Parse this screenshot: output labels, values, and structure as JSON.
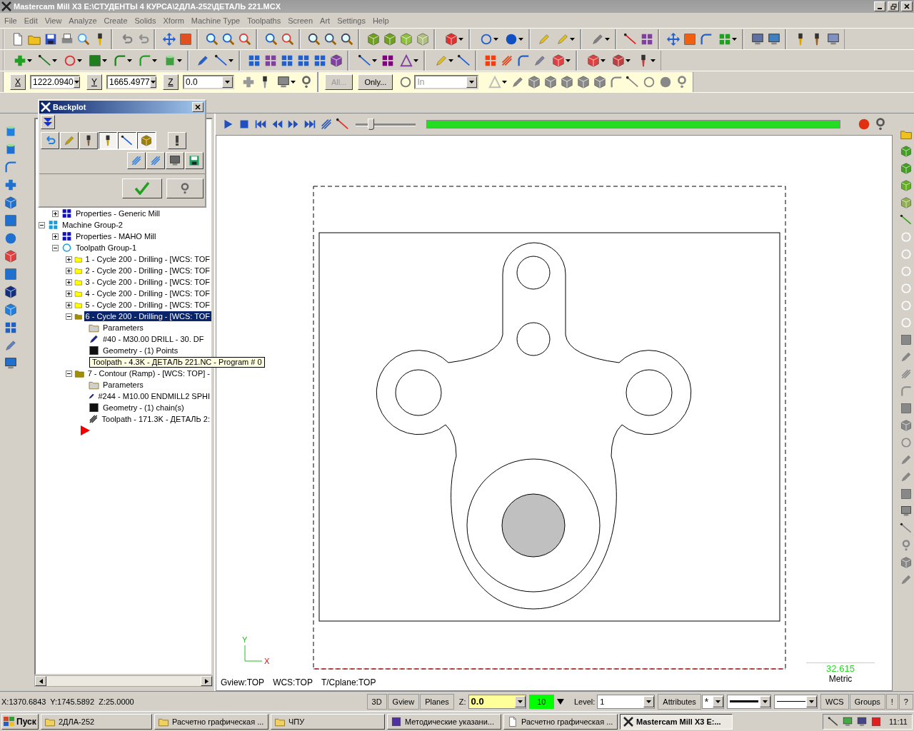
{
  "window": {
    "title": "Mastercam Mill X3  E:\\СТУДЕНТЫ 4 КУРСА\\2ДЛА-252\\ДЕТАЛЬ 221.MCX"
  },
  "menu": [
    "File",
    "Edit",
    "View",
    "Analyze",
    "Create",
    "Solids",
    "Xform",
    "Machine Type",
    "Toolpaths",
    "Screen",
    "Art",
    "Settings",
    "Help"
  ],
  "coordinate_bar": {
    "x_label": "X",
    "x_value": "1222.0940",
    "y_label": "Y",
    "y_value": "1665.4977",
    "z_label": "Z",
    "z_value": "0.0",
    "all_button": "All...",
    "only_button": "Only...",
    "units": "In"
  },
  "backplot": {
    "title": "Backplot",
    "display_options": [
      {
        "pressed": false
      },
      {
        "pressed": false
      },
      {
        "pressed": false
      },
      {
        "pressed": true
      },
      {
        "pressed": true
      },
      {
        "pressed": true
      }
    ]
  },
  "operations_tree": {
    "items": [
      {
        "children": [
          {
            "label": "Properties - Generic Mill",
            "kind": "properties",
            "expanded": false
          }
        ]
      },
      {
        "label": "Machine Group-2",
        "kind": "machine-group",
        "expanded": true,
        "selected": false,
        "children": [
          {
            "label": "Properties - MAHO Mill",
            "kind": "properties",
            "expanded": false,
            "selected": false
          },
          {
            "label": "Toolpath Group-1",
            "kind": "toolpath-group",
            "expanded": true,
            "selected": false,
            "children": [
              {
                "label": "1 - Cycle 200 - Drilling - [WCS: TOF",
                "kind": "folder",
                "expanded": false,
                "selected": false
              },
              {
                "label": "2 - Cycle 200 - Drilling - [WCS: TOF",
                "kind": "folder",
                "expanded": false,
                "selected": false
              },
              {
                "label": "3 - Cycle 200 - Drilling - [WCS: TOF",
                "kind": "folder",
                "expanded": false,
                "selected": false
              },
              {
                "label": "4 - Cycle 200 - Drilling - [WCS: TOF",
                "kind": "folder",
                "expanded": false,
                "selected": false
              },
              {
                "label": "5 - Cycle 200 - Drilling - [WCS: TOF",
                "kind": "folder",
                "expanded": false,
                "selected": false
              },
              {
                "label": "6 - Cycle 200 - Drilling - [WCS: TOF",
                "kind": "open-folder",
                "expanded": true,
                "selected": true,
                "children": [
                  {
                    "label": "Parameters",
                    "kind": "parameters",
                    "selected": false
                  },
                  {
                    "label": "#40 - M30.00 DRILL -    30. DF",
                    "kind": "tool",
                    "selected": false
                  },
                  {
                    "label": "Geometry - (1) Points",
                    "kind": "geometry",
                    "selected": false
                  },
                  {
                    "label": "Toolpath - 4.3K - ДЕТАЛЬ 221.NC - Program # 0",
                    "kind": "toolpath",
                    "selected": false,
                    "tooltip": true
                  }
                ]
              },
              {
                "label": "7 - Contour (Ramp) - [WCS: TOP] -",
                "kind": "open-folder",
                "expanded": true,
                "selected": false,
                "children": [
                  {
                    "label": "Parameters",
                    "kind": "parameters",
                    "selected": false
                  },
                  {
                    "label": "#244 - M10.00 ENDMILL2 SPHI",
                    "kind": "tool",
                    "selected": false
                  },
                  {
                    "label": "Geometry - (1) chain(s)",
                    "kind": "geometry",
                    "selected": false
                  },
                  {
                    "label": "Toolpath - 171.3K - ДЕТАЛЬ 2:",
                    "kind": "toolpath",
                    "selected": false
                  }
                ]
              }
            ]
          }
        ]
      }
    ]
  },
  "backplot_progress": {
    "level": 1
  },
  "speed_slider": {
    "level": 0.25
  },
  "view_labels": [
    "Gview:TOP",
    "WCS:TOP",
    "T/Cplane:TOP"
  ],
  "scale": {
    "value": "32.615",
    "units": "Metric"
  },
  "axes": {
    "y": "Y",
    "x": "X"
  },
  "status_bar": {
    "coordinates": "X:1370.6843  Y:1745.5892  Z:25.0000",
    "buttons": [
      "3D",
      "Gview",
      "Planes"
    ],
    "z_label": "Z:",
    "z_value": "0.0",
    "color_value": "10",
    "level_label": "Level:",
    "level_value": "1",
    "attributes": "Attributes",
    "point_style": "*",
    "wcs": "WCS",
    "groups": "Groups",
    "extra": [
      "!",
      "?"
    ]
  },
  "taskbar": {
    "start": "Пуск",
    "tasks": [
      {
        "label": "2ДЛА-252",
        "kind": "folder",
        "selected": false
      },
      {
        "label": "Расчетно графическая ...",
        "kind": "folder",
        "selected": false
      },
      {
        "label": "ЧПУ",
        "kind": "folder",
        "selected": false
      },
      {
        "label": "Методические указани...",
        "kind": "document",
        "selected": false
      },
      {
        "label": "Расчетно графическая ...",
        "kind": "word",
        "selected": false
      },
      {
        "label": "Mastercam Mill X3  E:...",
        "kind": "app",
        "selected": true
      }
    ],
    "clock": "11:11"
  }
}
